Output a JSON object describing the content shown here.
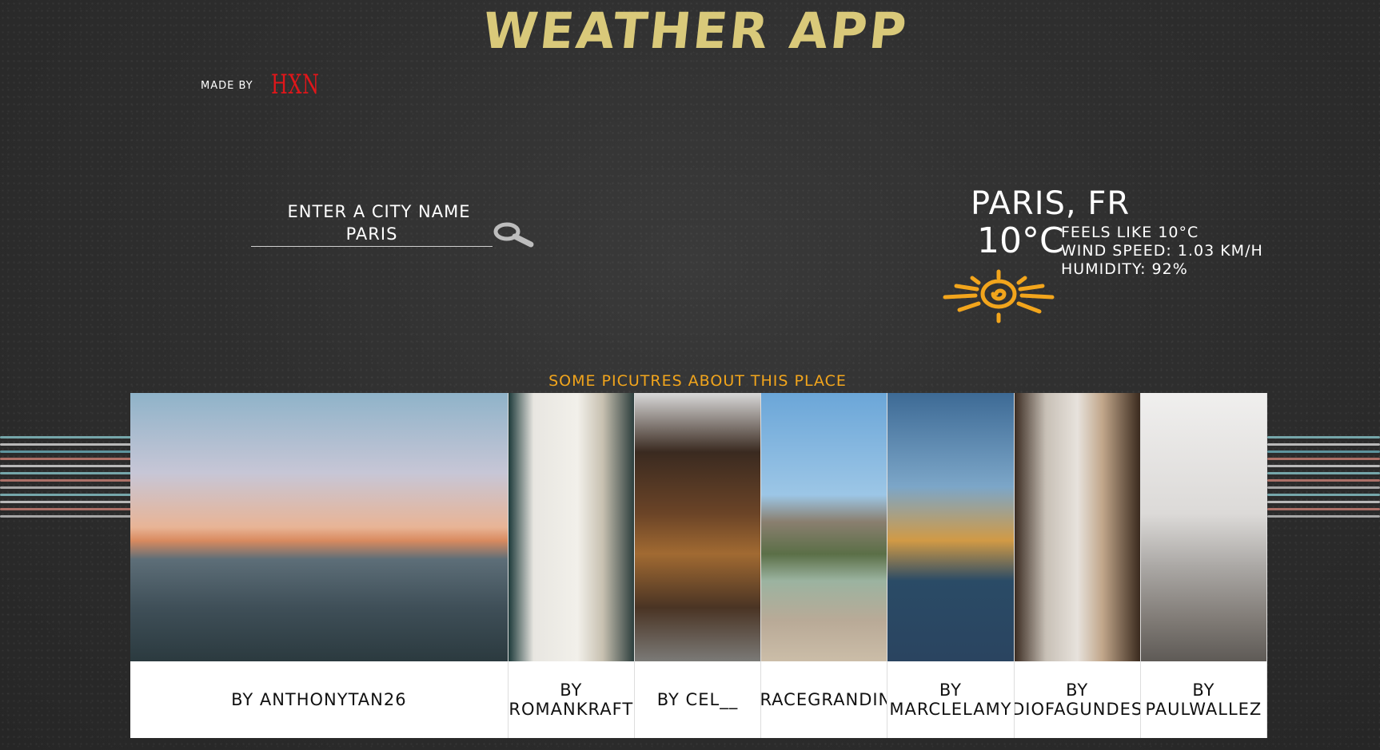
{
  "app": {
    "title": "WEATHER APP",
    "made_by_label": "MADE BY",
    "author": "HXN"
  },
  "search": {
    "label": "ENTER A CITY NAME",
    "value": "PARIS",
    "icon": "search-icon"
  },
  "weather": {
    "location": "PARIS, FR",
    "temperature": "10°C",
    "feels_like": "FEELS LIKE 10°C",
    "wind_speed": "WIND SPEED: 1.03 KM/H",
    "humidity": "HUMIDITY: 92%",
    "condition_icon": "sun-icon"
  },
  "gallery": {
    "heading": "SOME PICUTRES ABOUT THIS PLACE",
    "items": [
      {
        "caption": "BY ANTHONYTAN26"
      },
      {
        "caption": "BY ROMANKRAFT"
      },
      {
        "caption": "BY CEL__"
      },
      {
        "caption": "BY GRACEGRANDINETTI"
      },
      {
        "caption": "BY MARCLELAMY"
      },
      {
        "caption": "BY DIOFAGUNDES"
      },
      {
        "caption": "BY PAULWALLEZ"
      }
    ]
  },
  "colors": {
    "title": "#d9c97a",
    "author": "#e0161a",
    "heading": "#f2a51c",
    "sun": "#f2a51c"
  }
}
